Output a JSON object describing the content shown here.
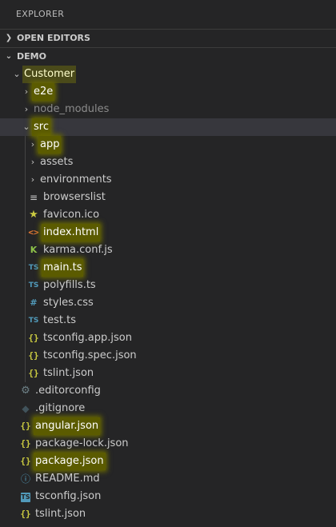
{
  "panel": {
    "title": "EXPLORER"
  },
  "sections": {
    "open_editors": "OPEN EDITORS",
    "demo": "DEMO"
  },
  "tree": {
    "customer": "Customer",
    "e2e": "e2e",
    "node_modules": "node_modules",
    "src": "src",
    "src_children": {
      "app": "app",
      "assets": "assets",
      "environments": "environments",
      "browserslist": "browserslist",
      "favicon": "favicon.ico",
      "index_html": "index.html",
      "karma": "karma.conf.js",
      "main_ts": "main.ts",
      "polyfills": "polyfills.ts",
      "styles": "styles.css",
      "test": "test.ts",
      "tsconfig_app": "tsconfig.app.json",
      "tsconfig_spec": "tsconfig.spec.json",
      "tslint_src": "tslint.json"
    },
    "root_files": {
      "editorconfig": ".editorconfig",
      "gitignore": ".gitignore",
      "angular_json": "angular.json",
      "package_lock": "package-lock.json",
      "package_json": "package.json",
      "readme": "README.md",
      "tsconfig": "tsconfig.json",
      "tslint": "tslint.json"
    }
  },
  "icons": {
    "chevron_right": "›",
    "chevron_down": "⌄",
    "json": "{}",
    "ts": "TS",
    "html": "<>",
    "css": "#",
    "karma": "K"
  },
  "colors": {
    "background": "#252526",
    "highlight": "#5b5b00",
    "json": "#cbcb41",
    "ts": "#519aba",
    "html": "#e37933"
  }
}
